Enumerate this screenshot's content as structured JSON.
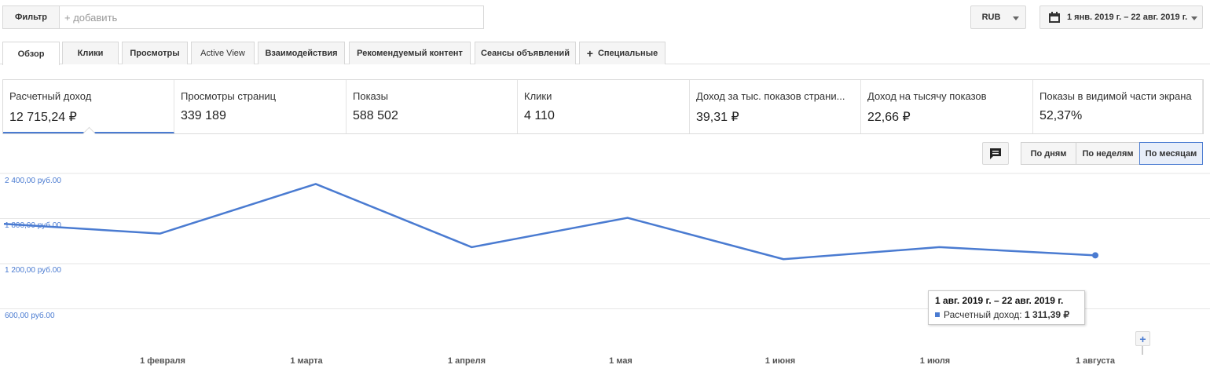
{
  "filter": {
    "button_label": "Фильтр",
    "placeholder": "+ добавить"
  },
  "currency": {
    "selected": "RUB"
  },
  "date_range": {
    "label": "1 янв. 2019 г. – 22 авг. 2019 г."
  },
  "tabs": [
    {
      "label": "Обзор",
      "active": true
    },
    {
      "label": "Клики"
    },
    {
      "label": "Просмотры"
    },
    {
      "label": "Active View"
    },
    {
      "label": "Взаимодействия"
    },
    {
      "label": "Рекомендуемый контент"
    },
    {
      "label": "Сеансы объявлений"
    },
    {
      "label": "Специальные"
    }
  ],
  "metrics": [
    {
      "label": "Расчетный доход",
      "value": "12 715,24 ₽"
    },
    {
      "label": "Просмотры страниц",
      "value": "339 189"
    },
    {
      "label": "Показы",
      "value": "588 502"
    },
    {
      "label": "Клики",
      "value": "4 110"
    },
    {
      "label": "Доход за тыс. показов страни...",
      "value": "39,31 ₽"
    },
    {
      "label": "Доход на тысячу показов",
      "value": "22,66 ₽"
    },
    {
      "label": "Показы в видимой части экрана",
      "value": "52,37%"
    }
  ],
  "granularity": {
    "day": "По дням",
    "week": "По неделям",
    "month": "По месяцам",
    "selected": "month"
  },
  "icons": {
    "comment": "comment-icon",
    "calendar": "calendar-icon",
    "plus": "plus-icon"
  },
  "colors": {
    "accent": "#4a7bd1"
  },
  "chart_data": {
    "type": "line",
    "ylabels": [
      "2 400,00 руб.00",
      "1 800,00 руб.00",
      "1 200,00 руб.00",
      "600,00 руб.00"
    ],
    "yticks": [
      2400,
      1800,
      1200,
      600
    ],
    "ylim": [
      0,
      2400
    ],
    "xlabels": [
      "1 февраля",
      "1 марта",
      "1 апреля",
      "1 мая",
      "1 июня",
      "1 июля",
      "1 августа"
    ],
    "series": [
      {
        "name": "Расчетный доход",
        "x": [
          "2019-01",
          "2019-02",
          "2019-03",
          "2019-04",
          "2019-05",
          "2019-06",
          "2019-07",
          "2019-08"
        ],
        "values": [
          1730,
          1600,
          2260,
          1420,
          1810,
          1260,
          1420,
          1311.39
        ]
      }
    ],
    "tooltip": {
      "title": "1 авг. 2019 г. – 22 авг. 2019 г.",
      "series": "Расчетный доход",
      "value": "1 311,39 ₽"
    }
  }
}
